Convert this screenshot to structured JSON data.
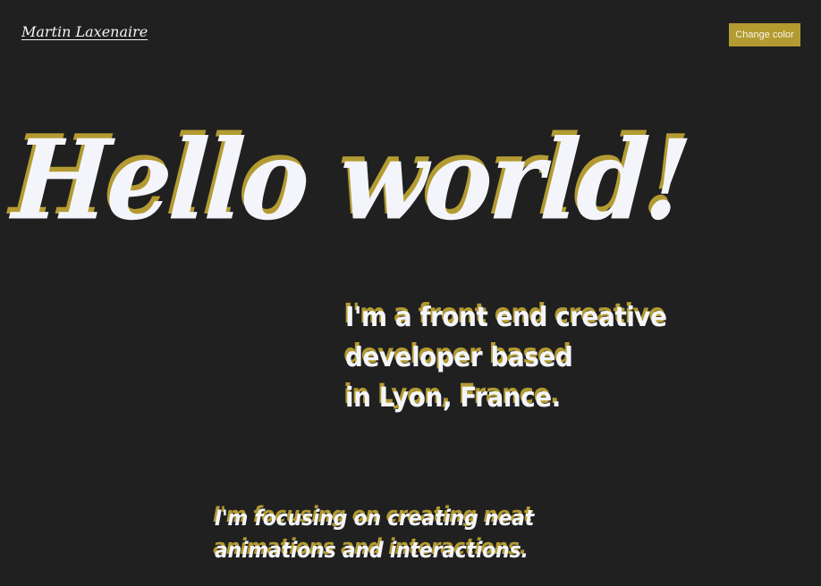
{
  "colors": {
    "background": "#202020",
    "text": "#f4f5fb",
    "accent": "#b39b32"
  },
  "header": {
    "site_name": "Martin Laxenaire",
    "change_color_label": "Change color"
  },
  "hero": {
    "title": "Hello world!"
  },
  "intro": {
    "lines": [
      "I'm a front end creative",
      "developer based",
      "in Lyon, France."
    ]
  },
  "focus": {
    "lines": [
      "I'm focusing on creating neat",
      "animations and interactions."
    ]
  }
}
